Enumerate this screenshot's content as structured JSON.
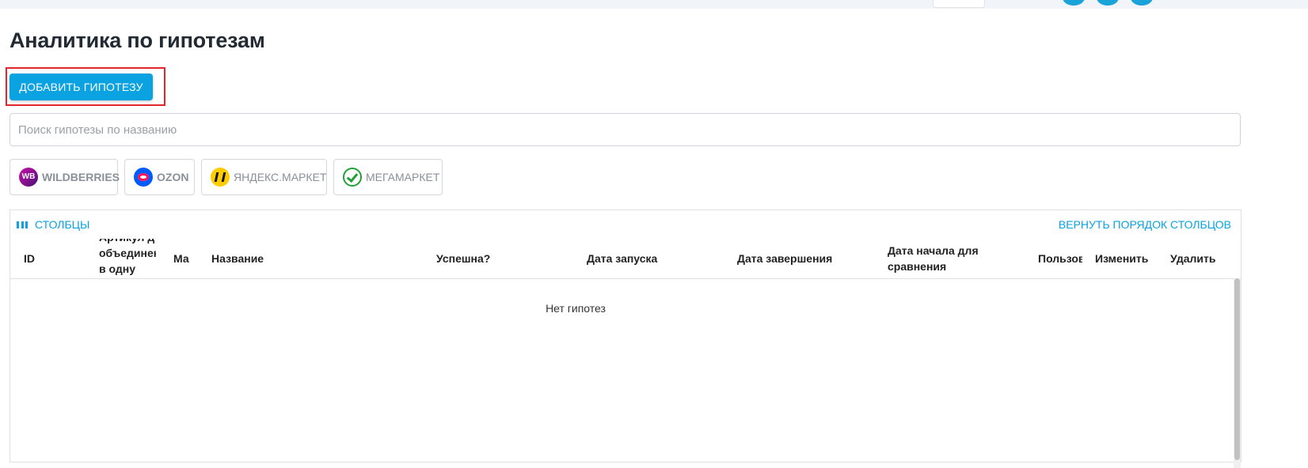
{
  "page": {
    "title": "Аналитика по гипотезам",
    "add_button_label": "ДОБАВИТЬ ГИПОТЕЗУ",
    "search_placeholder": "Поиск гипотезы по названию"
  },
  "marketplaces": [
    {
      "label": "WILDBERRIES",
      "logo_text": "WB",
      "icon": "wildberries-logo"
    },
    {
      "label": "OZON",
      "icon": "ozon-logo"
    },
    {
      "label": "ЯНДЕКС.МАРКЕТ",
      "icon": "yandex-market-logo"
    },
    {
      "label": "МЕГАМАРКЕТ",
      "icon": "megamarket-logo"
    }
  ],
  "table": {
    "columns_button": "СТОЛБЦЫ",
    "reset_columns_button": "ВЕРНУТЬ ПОРЯДОК СТОЛБЦОВ",
    "headers": [
      "ID",
      "Артикул д... объединен в одну",
      "Ма...",
      "Название",
      "Успешна?",
      "Дата запуска",
      "Дата завершения",
      "Дата начала для сравнения",
      "Пользов...",
      "Изменить",
      "Удалить"
    ],
    "header_visible": {
      "article_lines": [
        "Артикул д",
        "объединен",
        "в одну"
      ],
      "marketplace": "Ма",
      "user": "Пользов"
    },
    "empty_message": "Нет гипотез"
  },
  "colors": {
    "accent": "#0aa2e0",
    "highlight": "#e3262b",
    "topbar": "#f1f4f8"
  }
}
